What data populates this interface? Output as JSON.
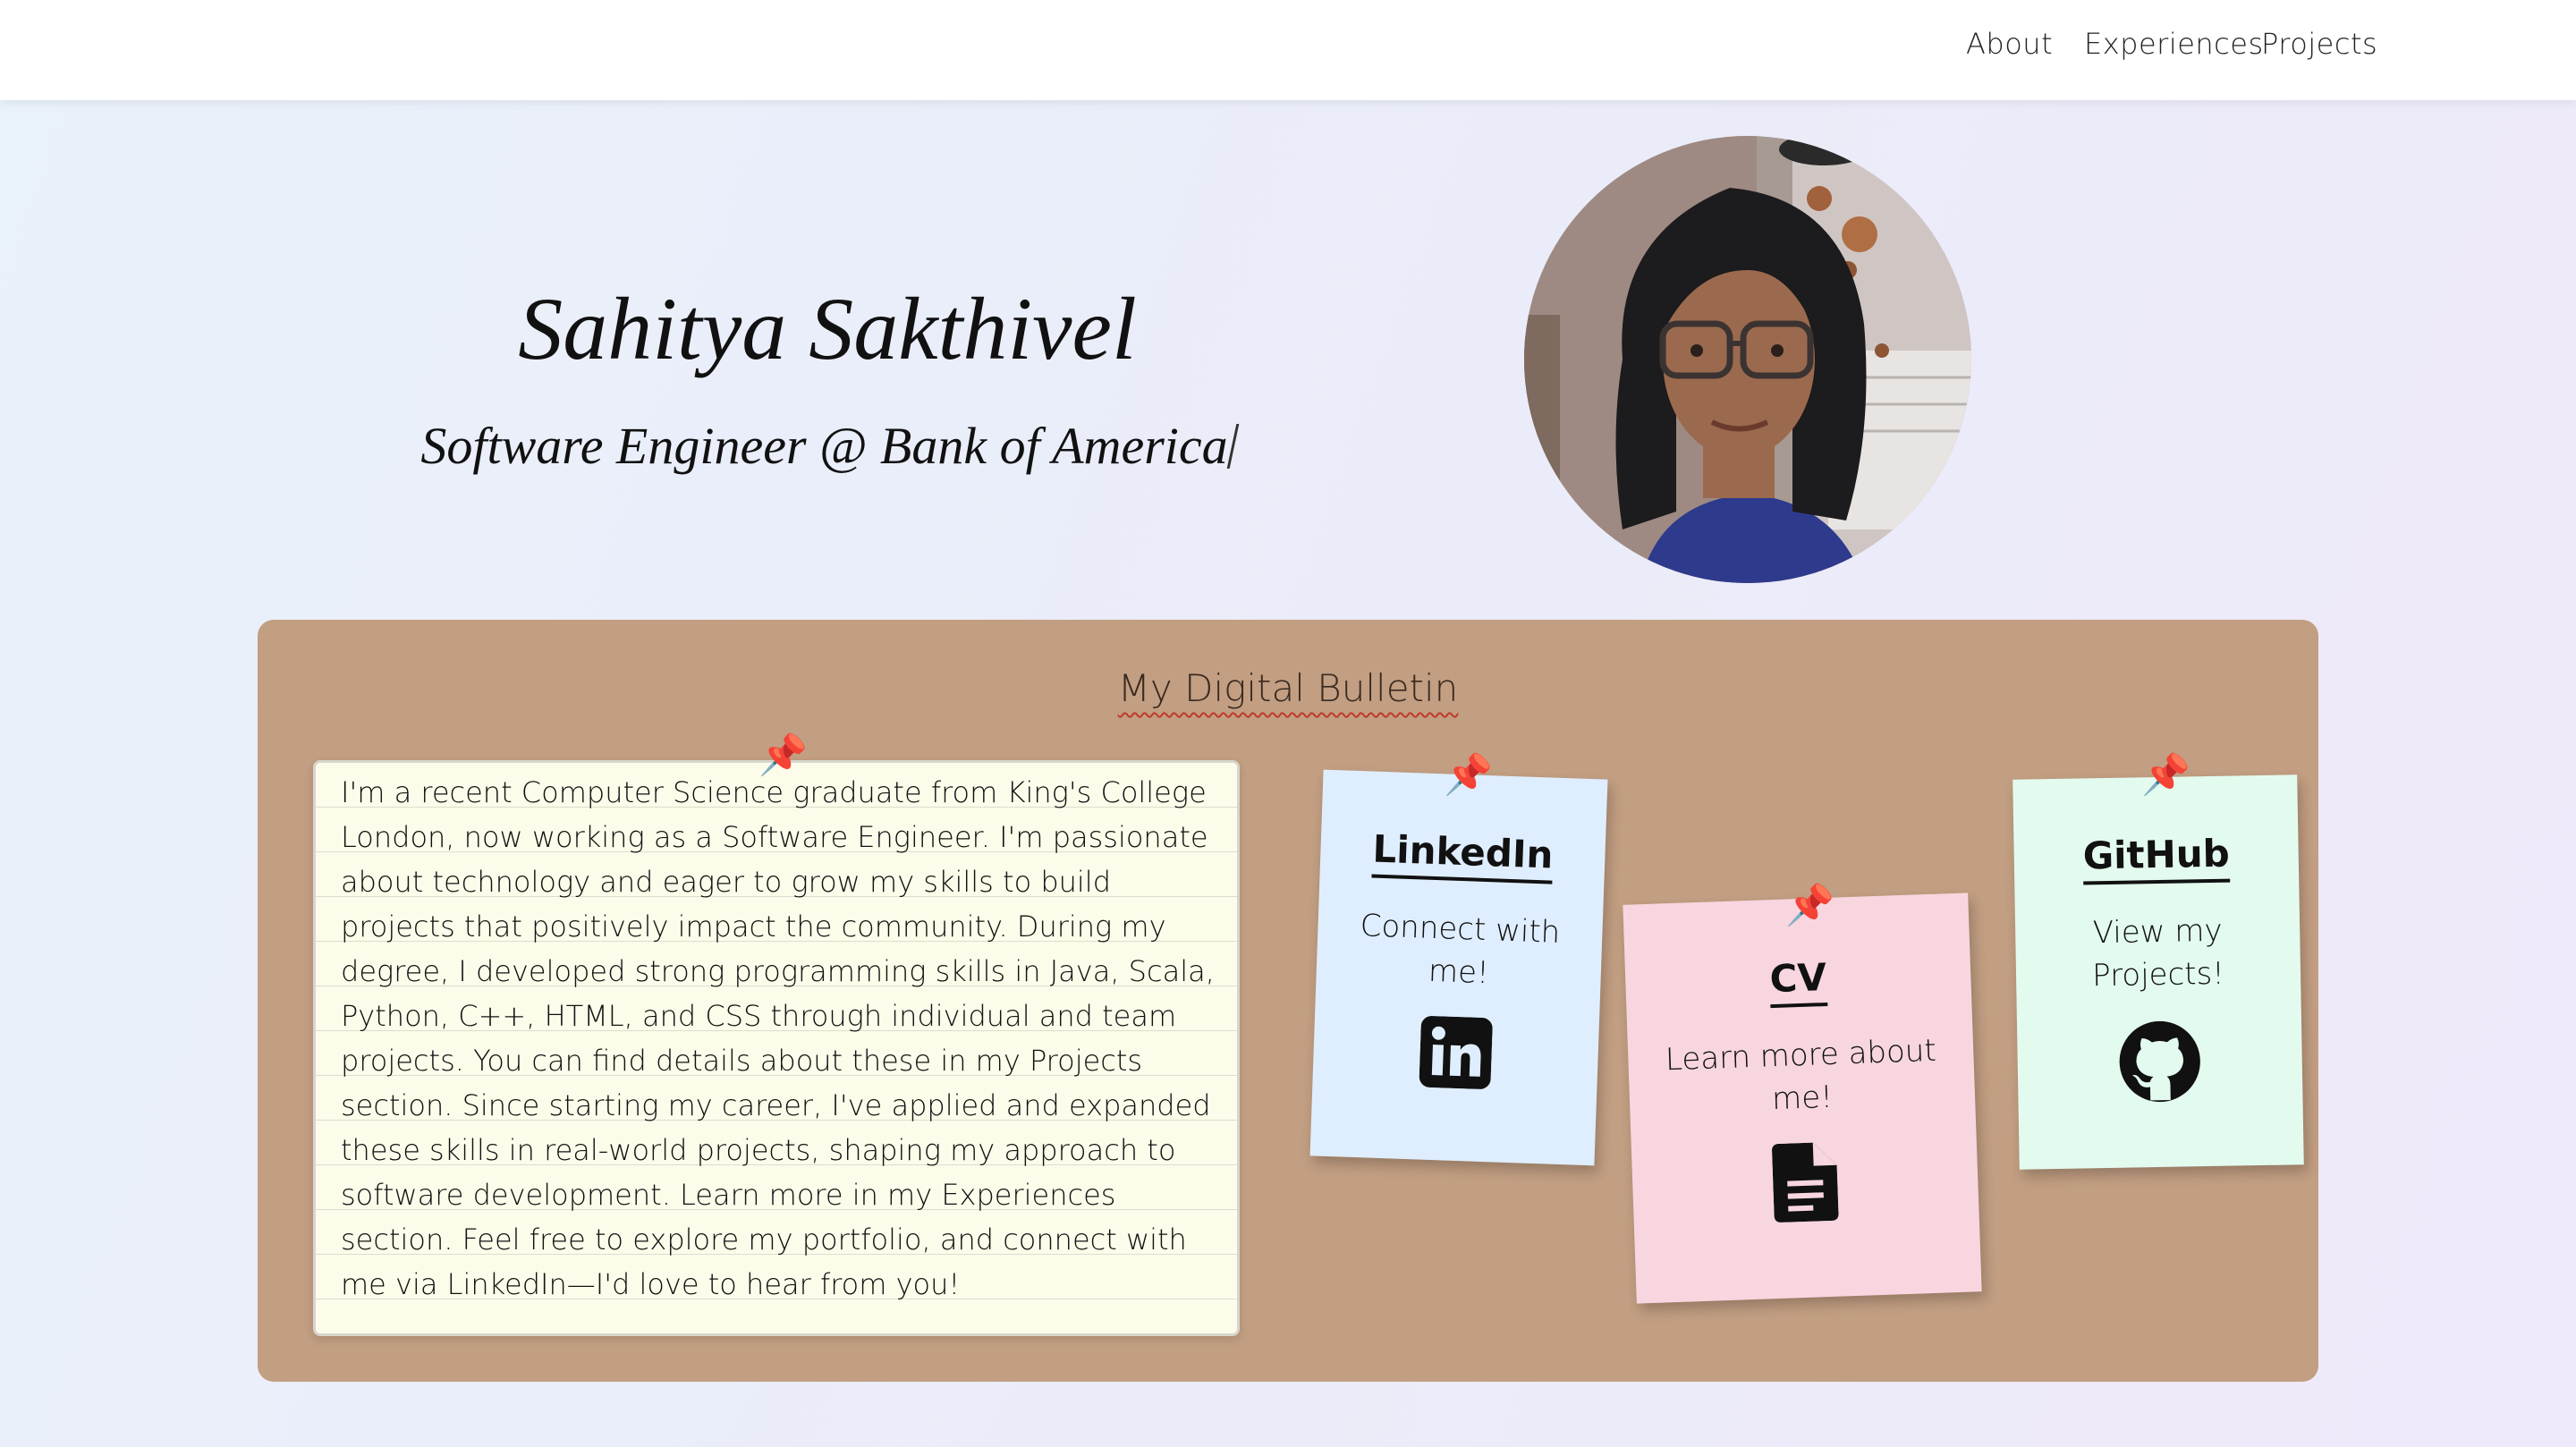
{
  "nav": {
    "links": [
      "About",
      "Experiences",
      "Projects"
    ]
  },
  "hero": {
    "name": "Sahitya Sakthivel",
    "role": "Software Engineer @ Bank of America"
  },
  "bulletin": {
    "title": "My Digital Bulletin",
    "about": "I'm a recent Computer Science graduate from King's College London, now working as a Software Engineer. I'm passionate about technology and eager to grow my skills to build projects that positively impact the community. During my degree, I developed strong programming skills in Java, Scala, Python, C++, HTML, and CSS through individual and team projects. You can find details about these in my Projects section. Since starting my career, I've applied and expanded these skills in real-world projects, shaping my approach to software development. Learn more in my Experiences section. Feel free to explore my portfolio, and connect with me via LinkedIn—I'd love to hear from you!",
    "cards": {
      "linkedin": {
        "title": "LinkedIn",
        "text": "Connect with me!",
        "icon": "linkedin-icon",
        "color": "#dfeefe"
      },
      "cv": {
        "title": "CV",
        "text": "Learn more about me!",
        "icon": "document-icon",
        "color": "#f8d6df"
      },
      "github": {
        "title": "GitHub",
        "text": "View my Projects!",
        "icon": "github-icon",
        "color": "#e3fbef"
      }
    }
  },
  "colors": {
    "board": "#c29e82",
    "note": "#fdfcea",
    "pin": "#d63a3a"
  }
}
